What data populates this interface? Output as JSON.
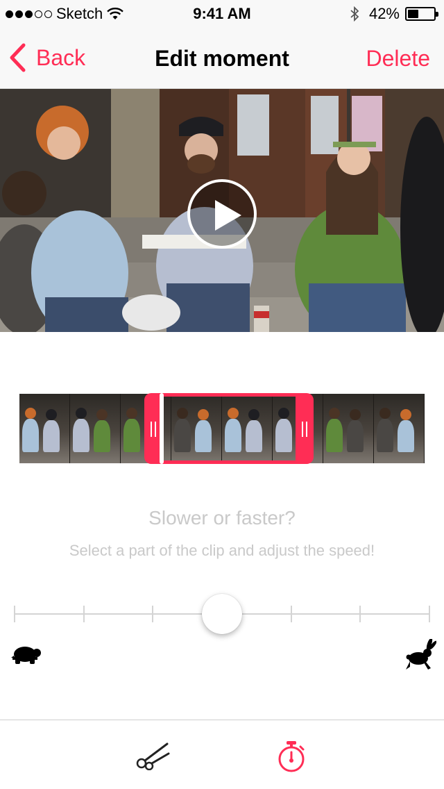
{
  "status_bar": {
    "carrier": "Sketch",
    "time": "9:41 AM",
    "battery_percent": "42%",
    "signal_bars_filled": 3,
    "signal_bars_total": 5,
    "battery_level": 0.42
  },
  "nav": {
    "back_label": "Back",
    "title": "Edit moment",
    "delete_label": "Delete"
  },
  "editor": {
    "heading": "Slower or faster?",
    "subheading": "Select a part of the clip and adjust the speed!",
    "speed_slider": {
      "steps": 7,
      "selected_step": 4
    }
  },
  "tabs": [
    {
      "name": "cut",
      "icon": "scissors-icon",
      "active": false
    },
    {
      "name": "speed",
      "icon": "stopwatch-icon",
      "active": true
    }
  ],
  "colors": {
    "accent": "#ff2d55",
    "muted_text": "#c9c9c9",
    "icon_dark": "#222222"
  }
}
